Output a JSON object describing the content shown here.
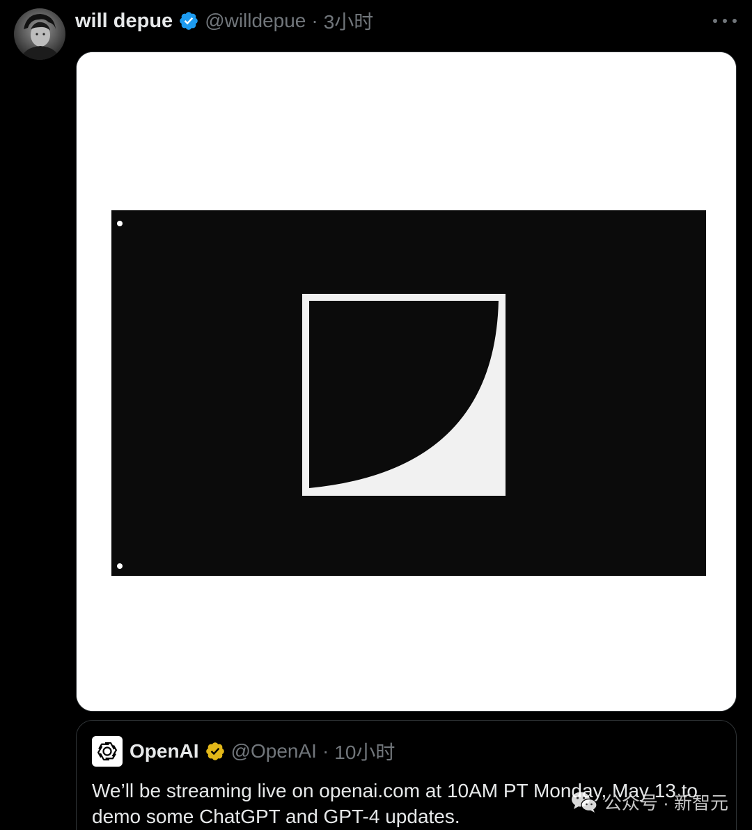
{
  "tweet": {
    "author_name": "will depue",
    "author_handle": "@willdepue",
    "separator": "·",
    "time": "3小时",
    "more_icon": "ellipsis-icon",
    "verified_badge": "blue-verified-icon",
    "media": {
      "description_icon": "flag-image",
      "background": "#ffffff",
      "flag_color": "#0b0b0b",
      "logo_color": "#ffffff"
    }
  },
  "quote": {
    "author_name": "OpenAI",
    "author_handle": "@OpenAI",
    "separator": "·",
    "time": "10小时",
    "verified_badge": "gold-verified-icon",
    "text": "We’ll be streaming live on openai.com at 10AM PT Monday, May 13 to demo some ChatGPT and GPT-4 updates."
  },
  "watermark": {
    "icon": "wechat-icon",
    "text": "公众号 · 新智元"
  },
  "colors": {
    "background": "#000000",
    "primary_text": "#e7e9ea",
    "secondary_text": "#71767b",
    "verified_blue": "#1d9bf0",
    "verified_gold": "#e2b719",
    "border": "#2f3336"
  }
}
